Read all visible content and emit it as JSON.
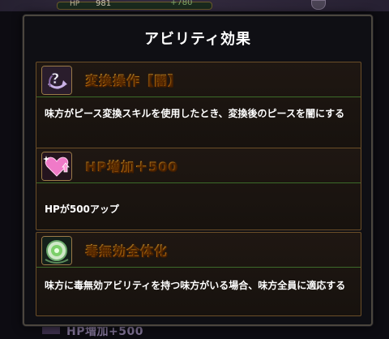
{
  "background": {
    "hp_label": "HP",
    "hp_value": "981",
    "hp_sub": "+780",
    "bottom_peek_text": "HP増加+500"
  },
  "dialog": {
    "title": "アビリティ効果",
    "abilities": [
      {
        "icon": "question-swap-icon",
        "name": "変換操作【闇】",
        "description": "味方がピース変換スキルを使用したとき、変換後のピースを闇にする"
      },
      {
        "icon": "heart-up-icon",
        "name": "HP増加＋500",
        "description": "HPが500アップ"
      },
      {
        "icon": "poison-shield-icon",
        "name": "毒無効全体化",
        "description": "味方に毒無効アビリティを持つ味方がいる場合、味方全員に適応する"
      }
    ]
  },
  "colors": {
    "title_gold": "#ffb020",
    "card_border": "#6b4e28",
    "divider_green": "#3c6b2a",
    "dialog_bg": "#0f0f14"
  }
}
